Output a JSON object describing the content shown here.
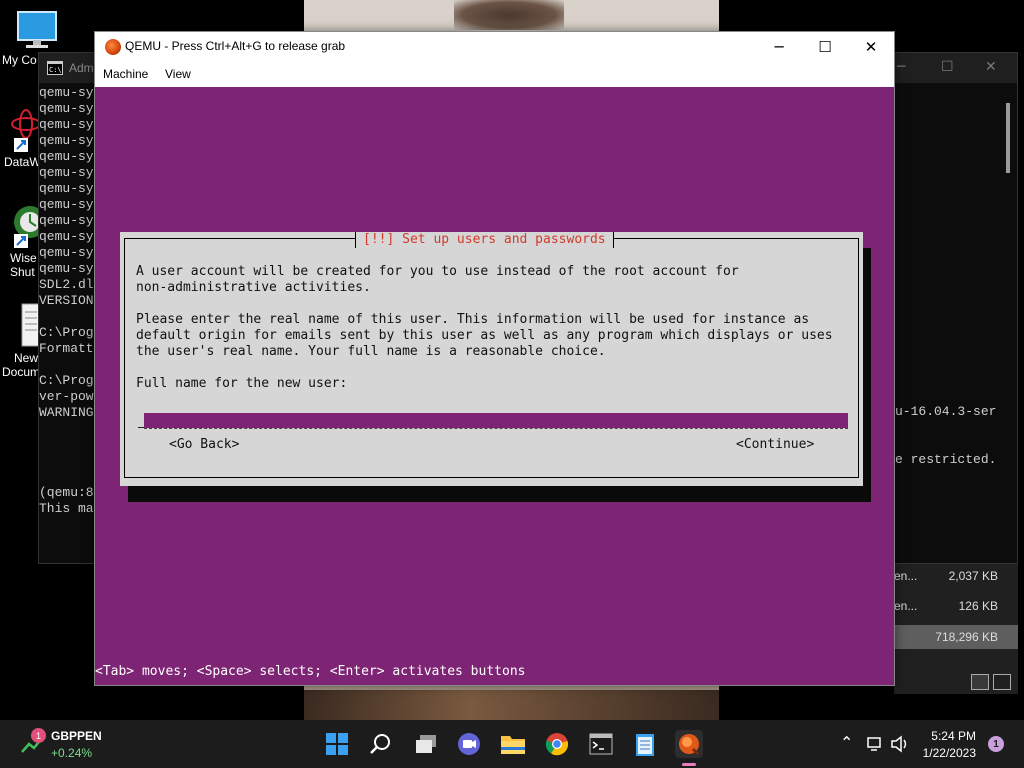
{
  "desktop": {
    "icons": [
      {
        "label": "My Co",
        "icon": "monitor-icon"
      },
      {
        "label": "DataW",
        "icon": "datawrapper-icon"
      },
      {
        "label": "Wise",
        "label2": "Shut",
        "icon": "wise-shutdown-icon"
      },
      {
        "label": "New",
        "label2": "Docum",
        "icon": "text-document-icon"
      }
    ]
  },
  "cmd_window": {
    "title": "Adm",
    "lines": [
      "qemu-sy",
      "qemu-sy",
      "qemu-sy",
      "qemu-sy",
      "qemu-sy",
      "qemu-sy",
      "qemu-sy",
      "qemu-sy",
      "qemu-sy",
      "qemu-sy",
      "qemu-sy",
      "qemu-sy",
      "SDL2.dl",
      "VERSION",
      "",
      "C:\\Prog",
      "Formatt",
      "",
      "C:\\Prog",
      "ver-pow",
      "WARNING",
      "",
      "",
      "",
      "",
      "(qemu:8",
      "This ma"
    ],
    "right_text_1": "u-16.04.3-ser",
    "right_text_2": "e restricted."
  },
  "explorer": {
    "rows": [
      {
        "name": "en...",
        "size": "2,037 KB"
      },
      {
        "name": "en...",
        "size": "126 KB"
      },
      {
        "name": "",
        "size": "718,296 KB"
      }
    ]
  },
  "qemu": {
    "title": "QEMU - Press Ctrl+Alt+G to release grab",
    "menu": [
      "Machine",
      "View"
    ],
    "controls": {
      "minimize": "─",
      "maximize": "☐",
      "close": "✕"
    },
    "dialog": {
      "title": "[!!] Set up users and passwords",
      "paragraph1": "A user account will be created for you to use instead of the root account for\nnon-administrative activities.",
      "paragraph2": "Please enter the real name of this user. This information will be used for instance as\ndefault origin for emails sent by this user as well as any program which displays or uses\nthe user's real name. Your full name is a reasonable choice.",
      "field_label": "Full name for the new user:",
      "field_value": "",
      "go_back": "<Go Back>",
      "continue": "<Continue>"
    },
    "status_line": "<Tab> moves; <Space> selects; <Enter> activates buttons",
    "colors": {
      "installer_bg": "#7d2574",
      "dialog_bg": "#d6d6d6",
      "dialog_title": "#d23a2a"
    }
  },
  "taskbar": {
    "ticker": {
      "badge": "1",
      "name": "GBPPEN",
      "change": "+0.24%"
    },
    "apps": [
      "start-icon",
      "search-icon",
      "task-view-icon",
      "video-chat-icon",
      "file-explorer-icon",
      "chrome-icon",
      "terminal-icon",
      "notepad-icon",
      "qemu-icon"
    ],
    "time": "5:24 PM",
    "date": "1/22/2023",
    "notifications": "1"
  }
}
